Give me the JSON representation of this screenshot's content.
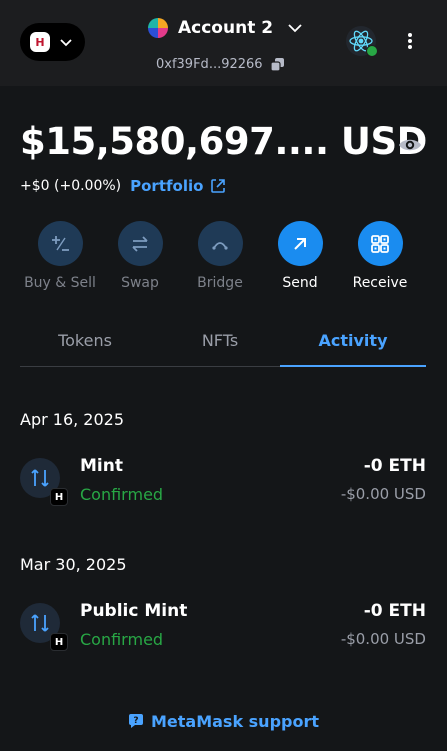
{
  "header": {
    "network_badge": "H",
    "account_name": "Account 2",
    "address": "0xf39Fd...92266"
  },
  "balance": {
    "amount": "$15,580,697....  USD",
    "change": "+$0 (+0.00%)",
    "portfolio_label": "Portfolio"
  },
  "actions": [
    {
      "label": "Buy & Sell",
      "icon": "plus-minus-icon"
    },
    {
      "label": "Swap",
      "icon": "swap-arrows-icon"
    },
    {
      "label": "Bridge",
      "icon": "bridge-arc-icon"
    },
    {
      "label": "Send",
      "icon": "arrow-up-right-icon"
    },
    {
      "label": "Receive",
      "icon": "qr-code-icon"
    }
  ],
  "tabs": [
    {
      "label": "Tokens"
    },
    {
      "label": "NFTs"
    },
    {
      "label": "Activity"
    }
  ],
  "activity": [
    {
      "date": "Apr 16, 2025",
      "title": "Mint",
      "status": "Confirmed",
      "amount": "-0 ETH",
      "fiat": "-$0.00 USD",
      "network_badge": "H"
    },
    {
      "date": "Mar 30, 2025",
      "title": "Public Mint",
      "status": "Confirmed",
      "amount": "-0 ETH",
      "fiat": "-$0.00 USD",
      "network_badge": "H"
    }
  ],
  "footer": {
    "support_label": "MetaMask support"
  },
  "colors": {
    "accent": "#4aa3ff",
    "confirmed": "#28a745",
    "background": "#141618"
  }
}
